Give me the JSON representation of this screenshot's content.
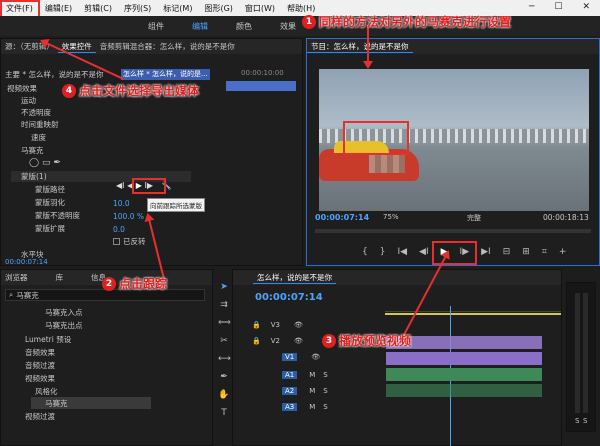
{
  "menu": [
    "文件(F)",
    "编辑(E)",
    "剪辑(C)",
    "序列(S)",
    "标记(M)",
    "图形(G)",
    "窗口(W)",
    "帮助(H)"
  ],
  "workspaces": [
    "组件",
    "编辑",
    "颜色",
    "效果"
  ],
  "source_tabs": [
    "源：（无剪辑）",
    "效果控件",
    "音频剪辑混合器：怎么样，说的是不是你"
  ],
  "effect_header": {
    "master": "主要 * 怎么样，说的是不是你",
    "clip": "怎么样 * 怎么样，说的是...",
    "time": "00:00:10:00"
  },
  "effect_rows": [
    "视频效果",
    "运动",
    "不透明度",
    "时间重映射",
    "速度",
    "马赛克",
    "蒙版(1)",
    "蒙版路径",
    "蒙版羽化",
    "蒙版不透明度",
    "蒙版扩展",
    "已反转",
    "水平块"
  ],
  "effect_values": {
    "feather": "10.0",
    "opacity": "100.0 %",
    "expand": "0.0"
  },
  "tooltip": "向前跟踪所选蒙版",
  "effect_timecode": "00:00:07:14",
  "program": {
    "title": "节目：怎么样，说的是不是你",
    "timecode": "00:00:07:14",
    "zoom": "75%",
    "quality": "完整",
    "duration": "00:00:18:13"
  },
  "project_tabs": [
    "浏览器",
    "库",
    "信息"
  ],
  "search_value": "马赛克",
  "project_items": [
    "马赛克入点",
    "马赛克出点",
    "Lumetri 预设",
    "音频效果",
    "音频过渡",
    "视频效果",
    "风格化",
    "马赛克",
    "视频过渡"
  ],
  "timeline": {
    "title": "怎么样，说的是不是你",
    "timecode": "00:00:07:14",
    "tracks": [
      "V3",
      "V2",
      "V1",
      "A1",
      "A2",
      "A3"
    ],
    "meter_labels": [
      "S",
      "S"
    ]
  },
  "callouts": {
    "c1": {
      "num": "1",
      "text": "同样的方法对另外的马赛克进行设置"
    },
    "c2": {
      "num": "2",
      "text": "点击跟踪"
    },
    "c3": {
      "num": "3",
      "text": "播放预览视频"
    },
    "c4": {
      "num": "4",
      "text": "点击文件选择导出媒体"
    }
  },
  "colors": {
    "accent": "#4fa3ff",
    "annotation": "#e02020",
    "clip_video": "#9b7fd4",
    "clip_audio": "#4fa86a"
  }
}
